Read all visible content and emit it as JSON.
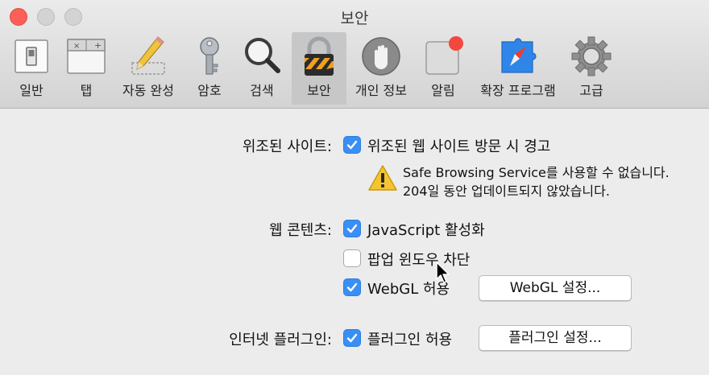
{
  "window": {
    "title": "보안"
  },
  "toolbar": {
    "tabs": [
      {
        "label": "일반",
        "icon": "general-switch-icon"
      },
      {
        "label": "탭",
        "icon": "tabs-icon"
      },
      {
        "label": "자동 완성",
        "icon": "pencil-icon"
      },
      {
        "label": "암호",
        "icon": "key-icon"
      },
      {
        "label": "검색",
        "icon": "magnifier-icon"
      },
      {
        "label": "보안",
        "icon": "lock-icon",
        "active": true
      },
      {
        "label": "개인 정보",
        "icon": "hand-icon"
      },
      {
        "label": "알림",
        "icon": "notification-badge-icon"
      },
      {
        "label": "확장 프로그램",
        "icon": "compass-icon"
      },
      {
        "label": "고급",
        "icon": "gear-icon"
      }
    ]
  },
  "fraud": {
    "label": "위조된 사이트:",
    "checkbox_label": "위조된 웹 사이트 방문 시 경고",
    "checked": true,
    "warning_line1": "Safe Browsing Service를 사용할 수 없습니다.",
    "warning_line2": "204일 동안 업데이트되지 않았습니다."
  },
  "web_content": {
    "label": "웹 콘텐츠:",
    "javascript_label": "JavaScript 활성화",
    "javascript_checked": true,
    "popup_label": "팝업 윈도우 차단",
    "popup_checked": false,
    "webgl_label": "WebGL 허용",
    "webgl_checked": true,
    "webgl_button": "WebGL 설정..."
  },
  "plugins": {
    "label": "인터넷 플러그인:",
    "allow_label": "플러그인 허용",
    "allow_checked": true,
    "settings_button": "플러그인 설정..."
  },
  "colors": {
    "accent": "#3a8ff5",
    "close": "#fc5f57",
    "warning": "#f5c531"
  }
}
